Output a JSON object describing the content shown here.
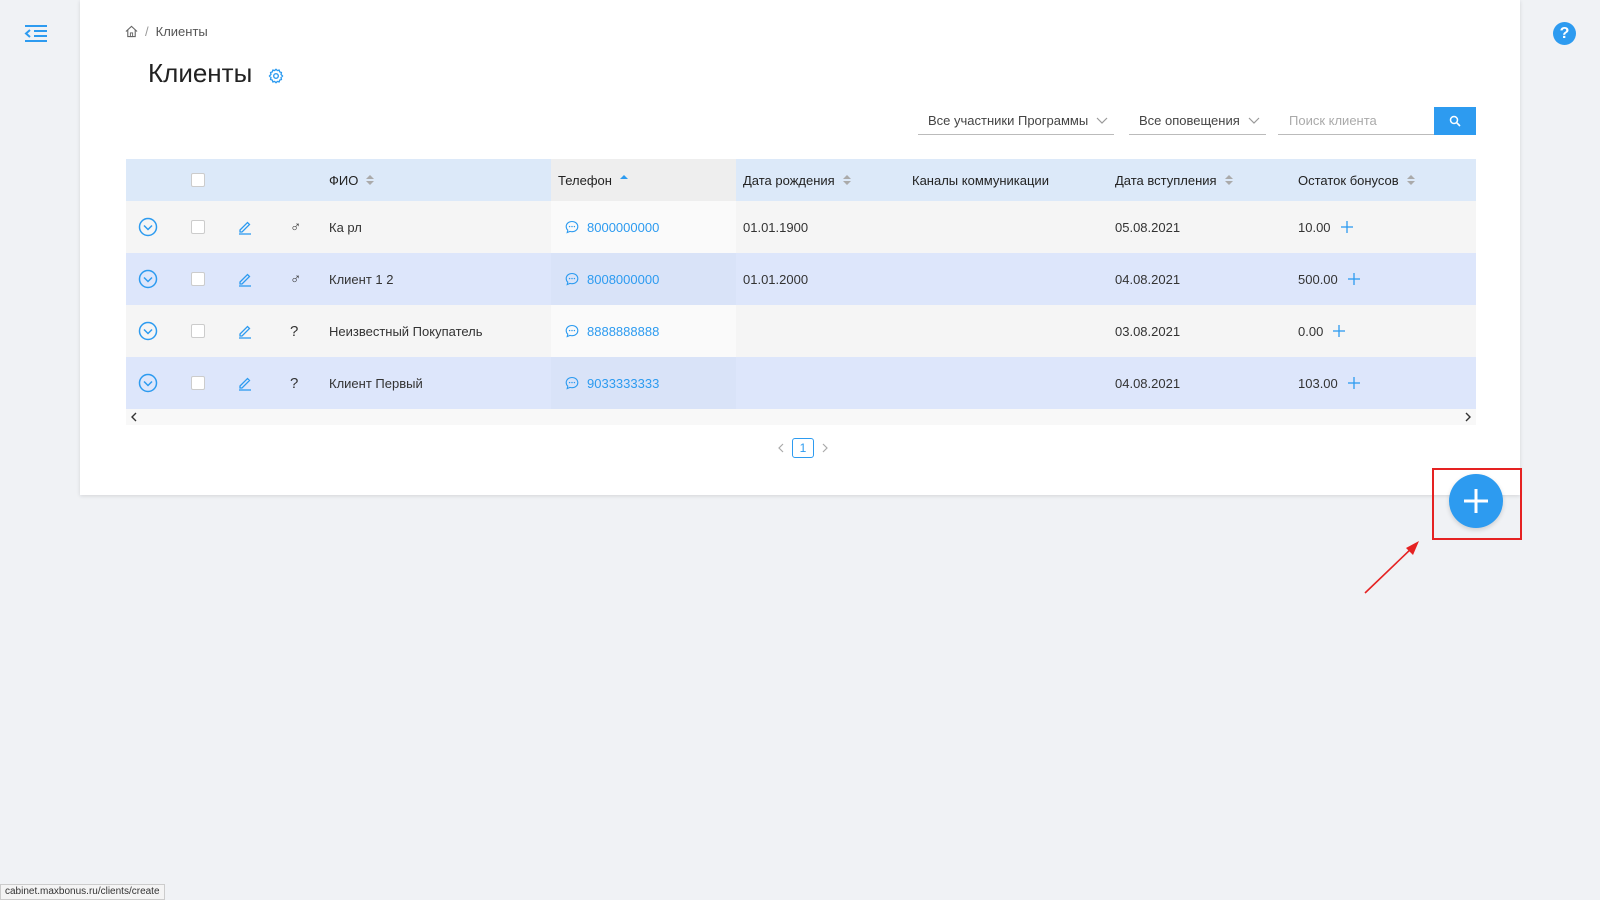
{
  "breadcrumb": {
    "home_icon": "home-icon",
    "current": "Клиенты"
  },
  "page": {
    "title": "Клиенты",
    "settings_icon": "gear-icon"
  },
  "filters": {
    "participants": "Все участники Программы",
    "notifications": "Все оповещения",
    "search_placeholder": "Поиск клиента"
  },
  "table": {
    "headers": {
      "name": "ФИО",
      "phone": "Телефон",
      "birth": "Дата рождения",
      "channels": "Каналы коммуникации",
      "joined": "Дата вступления",
      "bonus": "Остаток бонусов"
    },
    "rows": [
      {
        "gender": "♂",
        "name": "Ка рл",
        "phone": "8000000000",
        "birth": "01.01.1900",
        "joined": "05.08.2021",
        "bonus": "10.00"
      },
      {
        "gender": "♂",
        "name": "Клиент 1 2",
        "phone": "8008000000",
        "birth": "01.01.2000",
        "joined": "04.08.2021",
        "bonus": "500.00"
      },
      {
        "gender": "?",
        "name": "Неизвестный Покупатель",
        "phone": "8888888888",
        "birth": "",
        "joined": "03.08.2021",
        "bonus": "0.00"
      },
      {
        "gender": "?",
        "name": "Клиент Первый",
        "phone": "9033333333",
        "birth": "",
        "joined": "04.08.2021",
        "bonus": "103.00"
      }
    ]
  },
  "pagination": {
    "current": "1"
  },
  "status_bar": {
    "url": "cabinet.maxbonus.ru/clients/create"
  },
  "colors": {
    "accent": "#2d9bf0",
    "highlight": "#e52222"
  }
}
